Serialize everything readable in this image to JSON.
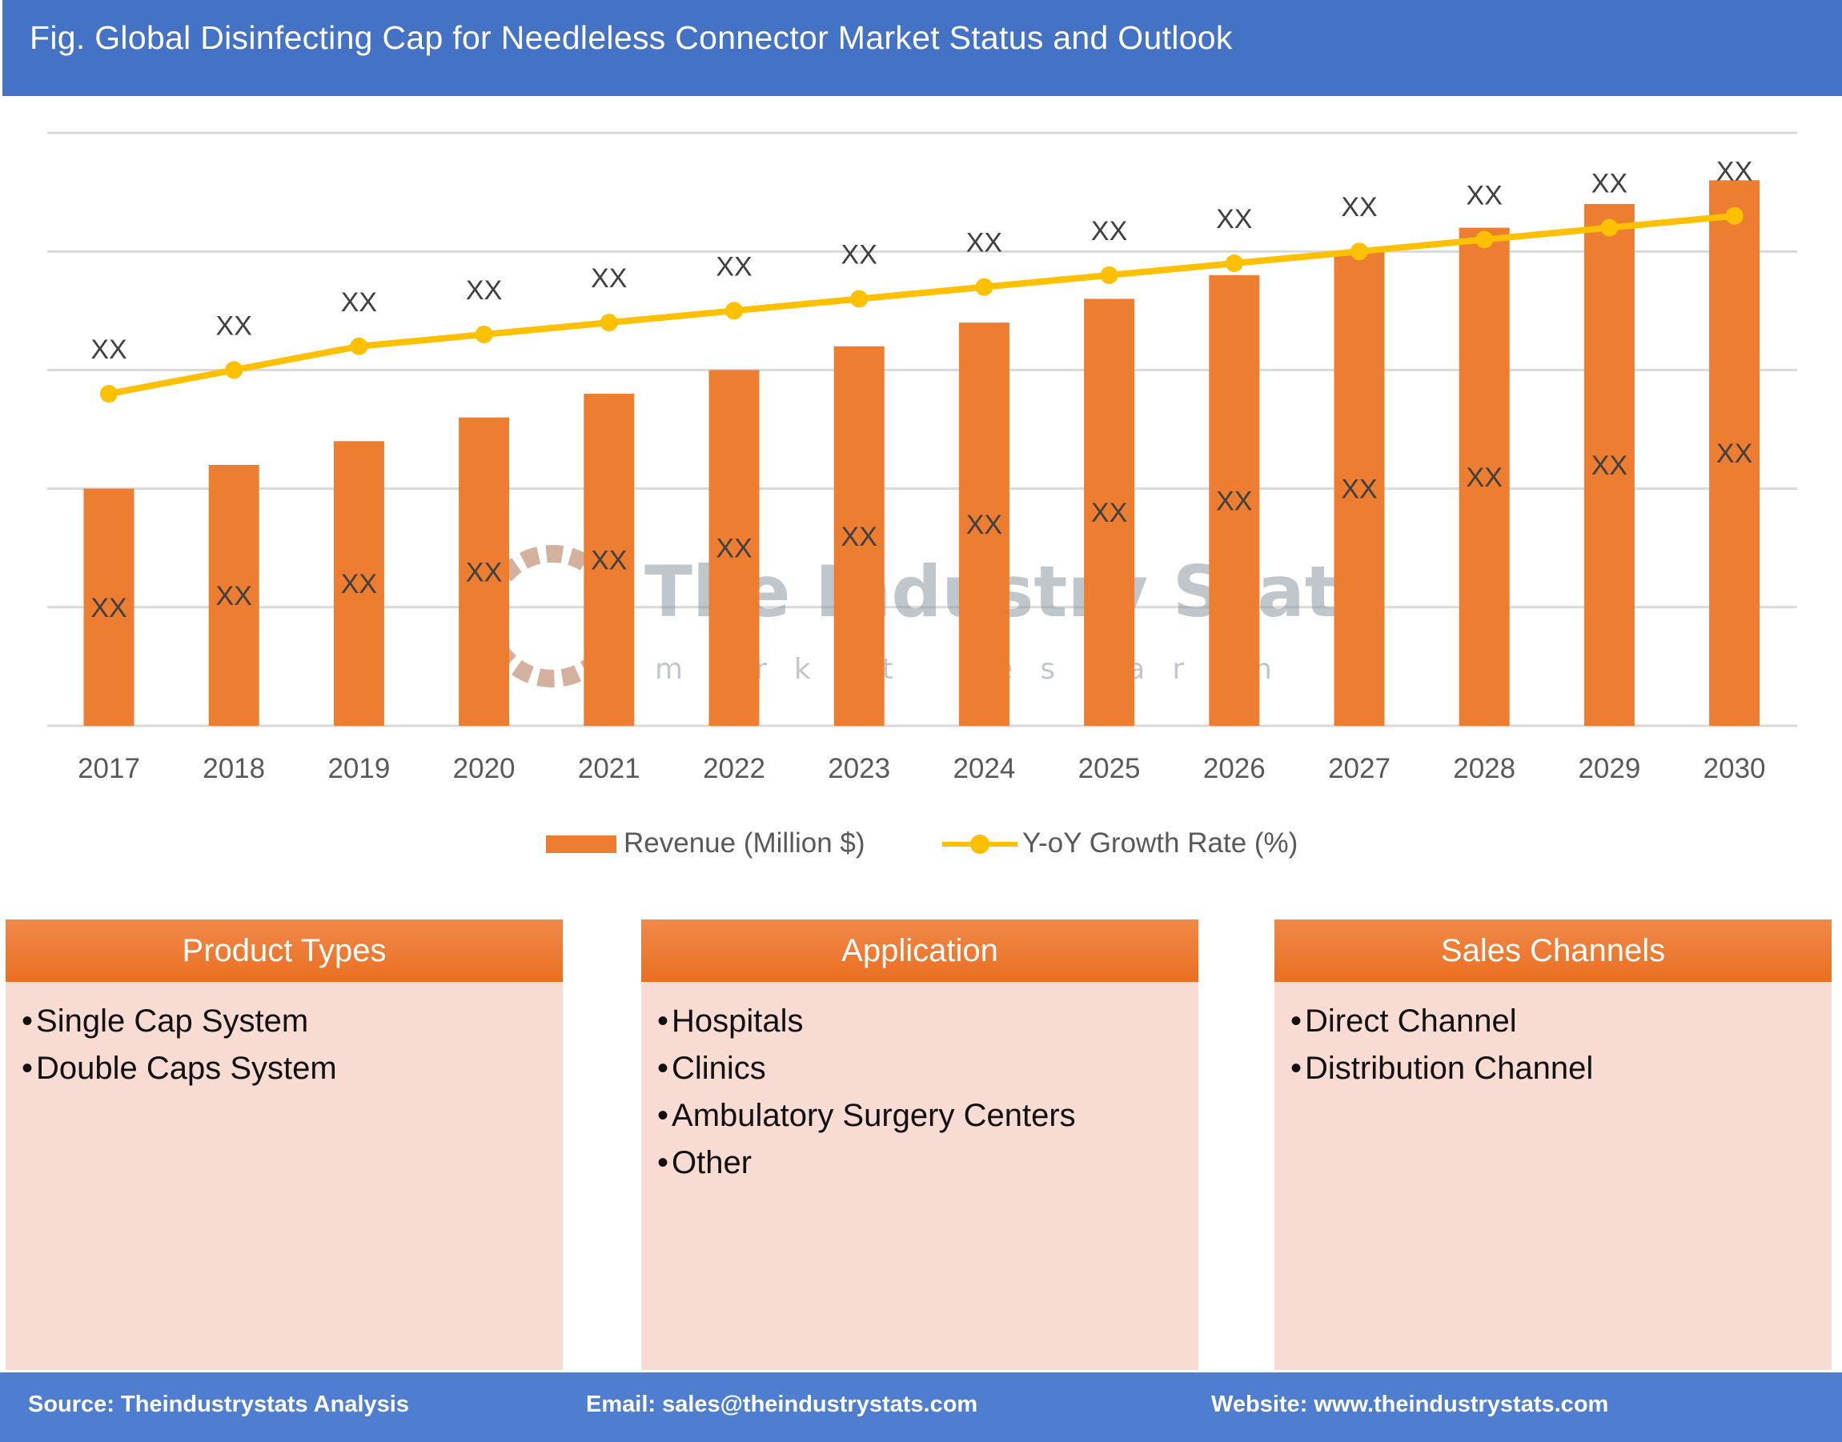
{
  "header": {
    "title": "Fig. Global Disinfecting Cap for Needleless Connector Market Status and Outlook"
  },
  "watermark": {
    "line1": "The Industry Stats",
    "line2": "market research"
  },
  "colors": {
    "header": "#4472c4",
    "bar": "#ed7d31",
    "line": "#ffc000",
    "panel_bg": "#f8dbd2",
    "footer": "#4f7dd0"
  },
  "chart_data": {
    "type": "bar+line",
    "categories": [
      "2017",
      "2018",
      "2019",
      "2020",
      "2021",
      "2022",
      "2023",
      "2024",
      "2025",
      "2026",
      "2027",
      "2028",
      "2029",
      "2030"
    ],
    "ylim": [
      0,
      5
    ],
    "grid": true,
    "legend_placement": "bottom",
    "series": [
      {
        "name": "Revenue (Million $)",
        "type": "bar",
        "values": [
          2.0,
          2.2,
          2.4,
          2.6,
          2.8,
          3.0,
          3.2,
          3.4,
          3.6,
          3.8,
          4.0,
          4.2,
          4.4,
          4.6
        ],
        "labels": [
          "XX",
          "XX",
          "XX",
          "XX",
          "XX",
          "XX",
          "XX",
          "XX",
          "XX",
          "XX",
          "XX",
          "XX",
          "XX",
          "XX"
        ]
      },
      {
        "name": "Y-oY Growth Rate (%)",
        "type": "line",
        "values": [
          2.8,
          3.0,
          3.2,
          3.3,
          3.4,
          3.5,
          3.6,
          3.7,
          3.8,
          3.9,
          4.0,
          4.1,
          4.2,
          4.3
        ],
        "labels": [
          "XX",
          "XX",
          "XX",
          "XX",
          "XX",
          "XX",
          "XX",
          "XX",
          "XX",
          "XX",
          "XX",
          "XX",
          "XX",
          "XX"
        ]
      }
    ]
  },
  "panels": [
    {
      "title": "Product Types",
      "items": [
        "Single Cap System",
        "Double Caps System"
      ]
    },
    {
      "title": "Application",
      "items": [
        "Hospitals",
        "Clinics",
        "Ambulatory Surgery Centers",
        "Other"
      ]
    },
    {
      "title": "Sales Channels",
      "items": [
        "Direct Channel",
        "Distribution Channel"
      ]
    }
  ],
  "footer": {
    "source": "Source: Theindustrystats Analysis",
    "email": "Email: sales@theindustrystats.com",
    "website": "Website: www.theindustrystats.com"
  }
}
